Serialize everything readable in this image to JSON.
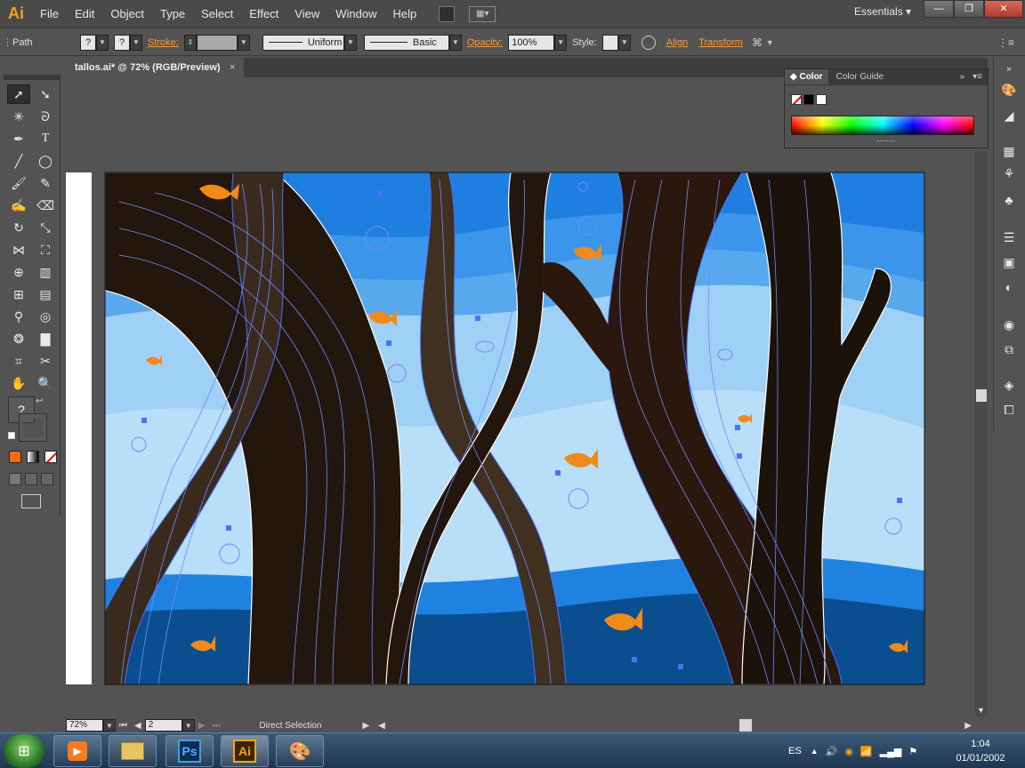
{
  "app": {
    "logo_text": "Ai",
    "workspace": "Essentials",
    "accent_color": "#f7a21b"
  },
  "menu": [
    "File",
    "Edit",
    "Object",
    "Type",
    "Select",
    "Effect",
    "View",
    "Window",
    "Help"
  ],
  "control_bar": {
    "selection_label": "Path",
    "fill_value": "?",
    "stroke_value": "?",
    "stroke_label": "Stroke:",
    "stroke_profile": "Uniform",
    "brush": "Basic",
    "opacity_label": "Opacity:",
    "opacity_value": "100%",
    "style_label": "Style:",
    "align_label": "Align",
    "transform_label": "Transform"
  },
  "document": {
    "tab_title": "tallos.ai* @ 72% (RGB/Preview)",
    "close_glyph": "×"
  },
  "toolbar": {
    "unknown_fill": "?",
    "tools": [
      "selection-tool",
      "direct-selection-tool",
      "magic-wand-tool",
      "lasso-tool",
      "pen-tool",
      "type-tool",
      "line-segment-tool",
      "ellipse-tool",
      "paintbrush-tool",
      "pencil-tool",
      "blob-brush-tool",
      "eraser-tool",
      "rotate-tool",
      "scale-tool",
      "width-tool",
      "free-transform-tool",
      "shape-builder-tool",
      "perspective-grid-tool",
      "mesh-tool",
      "gradient-tool",
      "eyedropper-tool",
      "blend-tool",
      "symbol-sprayer-tool",
      "column-graph-tool",
      "artboard-tool",
      "slice-tool",
      "hand-tool",
      "zoom-tool"
    ]
  },
  "color_panel": {
    "tabs": [
      "Color",
      "Color Guide"
    ],
    "active_tab": "Color"
  },
  "status_bar": {
    "zoom": "72%",
    "artboard": "2",
    "current_tool": "Direct Selection"
  },
  "taskbar": {
    "apps": [
      "windows-media-player",
      "windows-explorer",
      "photoshop",
      "illustrator",
      "paint"
    ],
    "ps_label": "Ps",
    "ai_label": "Ai",
    "language": "ES",
    "time": "1:04",
    "date": "01/01/2002"
  },
  "colors": {
    "sky_dark": "#1f7fe0",
    "sky_mid": "#58a8ee",
    "sky_light": "#9fd0f5",
    "water_deep": "#0b4e8f",
    "trunk_dark": "#23160c",
    "trunk_brown": "#3f3020",
    "fish": "#f08a1a",
    "selection_blue": "#4a72ff"
  }
}
